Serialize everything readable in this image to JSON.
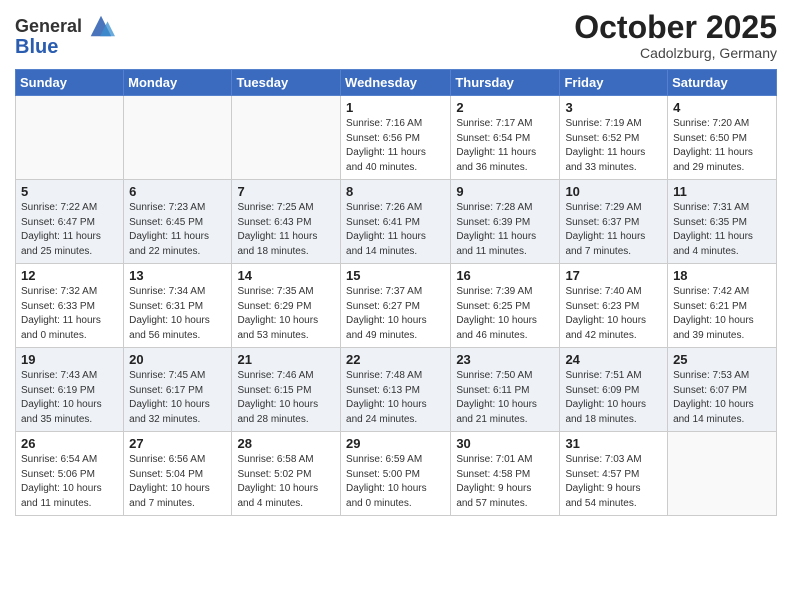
{
  "header": {
    "logo_line1": "General",
    "logo_line2": "Blue",
    "month": "October 2025",
    "location": "Cadolzburg, Germany"
  },
  "days_of_week": [
    "Sunday",
    "Monday",
    "Tuesday",
    "Wednesday",
    "Thursday",
    "Friday",
    "Saturday"
  ],
  "weeks": [
    [
      {
        "day": "",
        "info": ""
      },
      {
        "day": "",
        "info": ""
      },
      {
        "day": "",
        "info": ""
      },
      {
        "day": "1",
        "info": "Sunrise: 7:16 AM\nSunset: 6:56 PM\nDaylight: 11 hours\nand 40 minutes."
      },
      {
        "day": "2",
        "info": "Sunrise: 7:17 AM\nSunset: 6:54 PM\nDaylight: 11 hours\nand 36 minutes."
      },
      {
        "day": "3",
        "info": "Sunrise: 7:19 AM\nSunset: 6:52 PM\nDaylight: 11 hours\nand 33 minutes."
      },
      {
        "day": "4",
        "info": "Sunrise: 7:20 AM\nSunset: 6:50 PM\nDaylight: 11 hours\nand 29 minutes."
      }
    ],
    [
      {
        "day": "5",
        "info": "Sunrise: 7:22 AM\nSunset: 6:47 PM\nDaylight: 11 hours\nand 25 minutes."
      },
      {
        "day": "6",
        "info": "Sunrise: 7:23 AM\nSunset: 6:45 PM\nDaylight: 11 hours\nand 22 minutes."
      },
      {
        "day": "7",
        "info": "Sunrise: 7:25 AM\nSunset: 6:43 PM\nDaylight: 11 hours\nand 18 minutes."
      },
      {
        "day": "8",
        "info": "Sunrise: 7:26 AM\nSunset: 6:41 PM\nDaylight: 11 hours\nand 14 minutes."
      },
      {
        "day": "9",
        "info": "Sunrise: 7:28 AM\nSunset: 6:39 PM\nDaylight: 11 hours\nand 11 minutes."
      },
      {
        "day": "10",
        "info": "Sunrise: 7:29 AM\nSunset: 6:37 PM\nDaylight: 11 hours\nand 7 minutes."
      },
      {
        "day": "11",
        "info": "Sunrise: 7:31 AM\nSunset: 6:35 PM\nDaylight: 11 hours\nand 4 minutes."
      }
    ],
    [
      {
        "day": "12",
        "info": "Sunrise: 7:32 AM\nSunset: 6:33 PM\nDaylight: 11 hours\nand 0 minutes."
      },
      {
        "day": "13",
        "info": "Sunrise: 7:34 AM\nSunset: 6:31 PM\nDaylight: 10 hours\nand 56 minutes."
      },
      {
        "day": "14",
        "info": "Sunrise: 7:35 AM\nSunset: 6:29 PM\nDaylight: 10 hours\nand 53 minutes."
      },
      {
        "day": "15",
        "info": "Sunrise: 7:37 AM\nSunset: 6:27 PM\nDaylight: 10 hours\nand 49 minutes."
      },
      {
        "day": "16",
        "info": "Sunrise: 7:39 AM\nSunset: 6:25 PM\nDaylight: 10 hours\nand 46 minutes."
      },
      {
        "day": "17",
        "info": "Sunrise: 7:40 AM\nSunset: 6:23 PM\nDaylight: 10 hours\nand 42 minutes."
      },
      {
        "day": "18",
        "info": "Sunrise: 7:42 AM\nSunset: 6:21 PM\nDaylight: 10 hours\nand 39 minutes."
      }
    ],
    [
      {
        "day": "19",
        "info": "Sunrise: 7:43 AM\nSunset: 6:19 PM\nDaylight: 10 hours\nand 35 minutes."
      },
      {
        "day": "20",
        "info": "Sunrise: 7:45 AM\nSunset: 6:17 PM\nDaylight: 10 hours\nand 32 minutes."
      },
      {
        "day": "21",
        "info": "Sunrise: 7:46 AM\nSunset: 6:15 PM\nDaylight: 10 hours\nand 28 minutes."
      },
      {
        "day": "22",
        "info": "Sunrise: 7:48 AM\nSunset: 6:13 PM\nDaylight: 10 hours\nand 24 minutes."
      },
      {
        "day": "23",
        "info": "Sunrise: 7:50 AM\nSunset: 6:11 PM\nDaylight: 10 hours\nand 21 minutes."
      },
      {
        "day": "24",
        "info": "Sunrise: 7:51 AM\nSunset: 6:09 PM\nDaylight: 10 hours\nand 18 minutes."
      },
      {
        "day": "25",
        "info": "Sunrise: 7:53 AM\nSunset: 6:07 PM\nDaylight: 10 hours\nand 14 minutes."
      }
    ],
    [
      {
        "day": "26",
        "info": "Sunrise: 6:54 AM\nSunset: 5:06 PM\nDaylight: 10 hours\nand 11 minutes."
      },
      {
        "day": "27",
        "info": "Sunrise: 6:56 AM\nSunset: 5:04 PM\nDaylight: 10 hours\nand 7 minutes."
      },
      {
        "day": "28",
        "info": "Sunrise: 6:58 AM\nSunset: 5:02 PM\nDaylight: 10 hours\nand 4 minutes."
      },
      {
        "day": "29",
        "info": "Sunrise: 6:59 AM\nSunset: 5:00 PM\nDaylight: 10 hours\nand 0 minutes."
      },
      {
        "day": "30",
        "info": "Sunrise: 7:01 AM\nSunset: 4:58 PM\nDaylight: 9 hours\nand 57 minutes."
      },
      {
        "day": "31",
        "info": "Sunrise: 7:03 AM\nSunset: 4:57 PM\nDaylight: 9 hours\nand 54 minutes."
      },
      {
        "day": "",
        "info": ""
      }
    ]
  ]
}
